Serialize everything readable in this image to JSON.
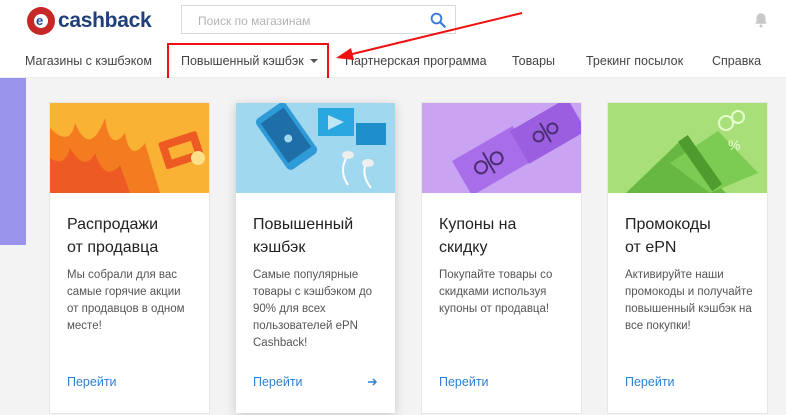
{
  "brand": {
    "name": "cashback",
    "logo_letter": "e"
  },
  "search": {
    "placeholder": "Поиск по магазинам"
  },
  "nav": {
    "items": [
      "Магазины с кэшбэком",
      "Повышенный кэшбэк",
      "Партнерская программа",
      "Товары",
      "Трекинг посылок",
      "Справка"
    ]
  },
  "cards": [
    {
      "title": "Распродажи\nот продавца",
      "desc": "Мы собрали для вас самые горячие акции от продавцов в одном месте!",
      "link": "Перейти",
      "image": "fire-tags-icon",
      "color": "#f9b233"
    },
    {
      "title": "Повышенный\nкэшбэк",
      "desc": "Самые популярные товары с кэшбэком до 90% для всех пользователей ePN Cashback!",
      "link": "Перейти",
      "image": "phone-earphones-icon",
      "color": "#9fd8ef"
    },
    {
      "title": "Купоны на\nскидку",
      "desc": "Покупайте товары со скидками используя купоны от продавца!",
      "link": "Перейти",
      "image": "coupon-percent-icon",
      "color": "#c9a4f3"
    },
    {
      "title": "Промокоды\nот ePN",
      "desc": "Активируйте наши промокоды и получайте повышенный кэшбэк на все покупки!",
      "link": "Перейти",
      "image": "gift-box-icon",
      "color": "#a8df78"
    }
  ],
  "colors": {
    "accent": "#2f80d1",
    "highlight_box": "#e11111",
    "left_strip": "#9a93ec"
  }
}
